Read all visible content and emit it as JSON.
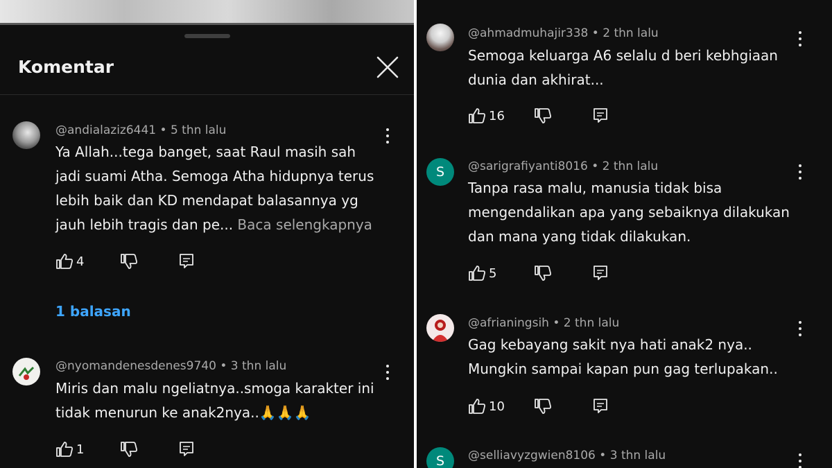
{
  "sheet": {
    "title": "Komentar",
    "replies_label": "1 balasan"
  },
  "left_comments": [
    {
      "author": "@andialaziz6441",
      "time": "5 thn lalu",
      "text": "Ya Allah...tega banget, saat Raul masih sah\njadi suami Atha. Semoga Atha hidupnya terus\nlebih baik dan KD mendapat balasannya yg\njauh lebih tragis dan pe...",
      "read_more": " Baca selengkapnya",
      "likes": "4"
    },
    {
      "author": "@nyomandenesdenes9740",
      "time": "3 thn lalu",
      "text": "Miris dan malu ngeliatnya..smoga karakter ini\ntidak menurun ke anak2nya..",
      "emoji": "🙏🙏🙏",
      "likes": "1"
    }
  ],
  "right_comments": [
    {
      "author": "@ahmadmuhajir338",
      "time": "2 thn lalu",
      "text": "Semoga keluarga A6 selalu d beri kebhgiaan\ndunia dan akhirat...",
      "likes": "16"
    },
    {
      "author": "@sarigrafiyanti8016",
      "time": "2 thn lalu",
      "avatar_letter": "S",
      "avatar_color": "#00897b",
      "text": "Tanpa rasa malu, manusia tidak bisa\nmengendalikan apa yang sebaiknya dilakukan\ndan mana yang tidak dilakukan.",
      "likes": "5"
    },
    {
      "author": "@afrianingsih",
      "time": "2 thn lalu",
      "text": "Gag kebayang sakit nya hati anak2 nya..\nMungkin sampai kapan pun gag terlupakan..",
      "likes": "10"
    },
    {
      "author": "@selliavyzgwien8106",
      "time": "3 thn lalu",
      "avatar_letter": "S",
      "avatar_color": "#00897b"
    }
  ],
  "icons": {
    "like": "thumb-up-icon",
    "dislike": "thumb-down-icon",
    "reply": "reply-comment-icon",
    "more": "more-vert-icon",
    "close": "close-icon"
  },
  "colors": {
    "background": "#0f0f0f",
    "text": "#f1f1f1",
    "secondary_text": "#aaaaaa",
    "link": "#3ea6ff"
  }
}
